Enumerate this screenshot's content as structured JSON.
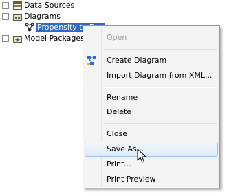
{
  "tree": {
    "items": [
      {
        "label": "Data Sources",
        "icon": "data-sources-icon"
      },
      {
        "label": "Diagrams",
        "icon": "diagrams-folder-icon"
      },
      {
        "label": "Propensity to Buy",
        "icon": "diagram-icon",
        "selected": true
      },
      {
        "label": "Model Packages",
        "icon": "model-packages-icon"
      }
    ]
  },
  "context_menu": {
    "items": [
      {
        "label": "Open",
        "disabled": true
      },
      {
        "label": "Create Diagram",
        "icon": "create-diagram-icon"
      },
      {
        "label": "Import Diagram from XML..."
      },
      {
        "label": "Rename"
      },
      {
        "label": "Delete"
      },
      {
        "label": "Close"
      },
      {
        "label": "Save As...",
        "hovered": true
      },
      {
        "label": "Print..."
      },
      {
        "label": "Print Preview"
      }
    ]
  },
  "colors": {
    "selection": "#3169c6",
    "menu_background": "#f4f4f4",
    "hover_border": "#9cc3ef",
    "disabled_text": "#9b9b9b"
  }
}
